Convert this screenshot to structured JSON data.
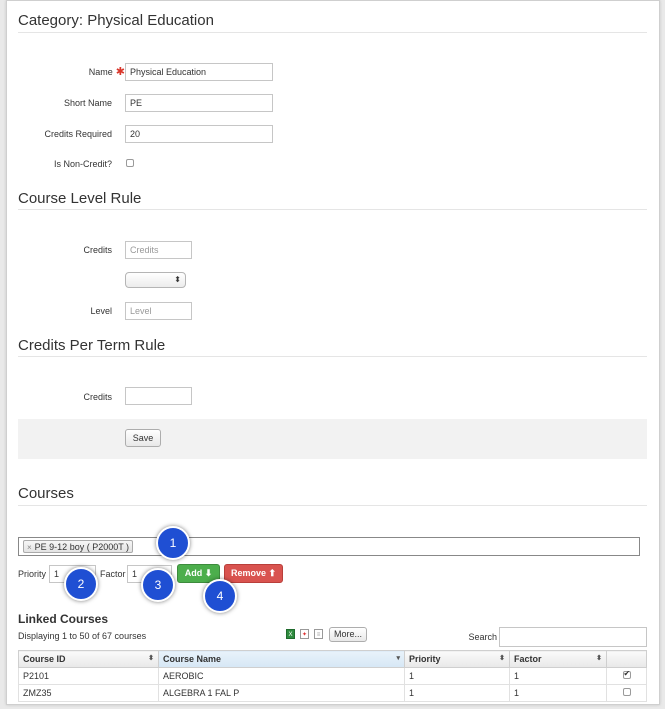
{
  "page_title": "Category: Physical Education",
  "fields": {
    "name_label": "Name",
    "name_required_mark": "✱",
    "name_value": "Physical Education",
    "short_name_label": "Short Name",
    "short_name_value": "PE",
    "credits_required_label": "Credits Required",
    "credits_required_value": "20",
    "non_credit_label": "Is Non-Credit?",
    "non_credit_checked": false
  },
  "course_level_rule": {
    "heading": "Course Level Rule",
    "credits_label": "Credits",
    "credits_placeholder": "Credits",
    "operator_value": "",
    "level_label": "Level",
    "level_placeholder": "Level"
  },
  "credits_per_term_rule": {
    "heading": "Credits Per Term Rule",
    "credits_label": "Credits",
    "credits_value": ""
  },
  "save_label": "Save",
  "courses": {
    "heading": "Courses",
    "selected_tag": "PE 9-12 boy ( P2000T )",
    "tag_remove_glyph": "×",
    "priority_label": "Priority",
    "priority_value": "1",
    "factor_label": "Factor",
    "factor_value": "1",
    "add_label": "Add ⬇",
    "remove_label": "Remove ⬆"
  },
  "callouts": [
    "1",
    "2",
    "3",
    "4"
  ],
  "linked_courses": {
    "heading": "Linked Courses",
    "displaying": "Displaying 1 to 50 of 67 courses",
    "more_label": "More...",
    "search_label": "Search",
    "search_value": "",
    "export_icons": [
      "excel-icon",
      "pdf-icon",
      "document-icon"
    ],
    "columns": [
      "Course ID",
      "Course Name",
      "Priority",
      "Factor",
      ""
    ],
    "rows": [
      {
        "course_id": "P2101",
        "course_name": "AEROBIC",
        "priority": "1",
        "factor": "1",
        "checked": true
      },
      {
        "course_id": "ZMZ35",
        "course_name": "ALGEBRA 1 FAL P",
        "priority": "1",
        "factor": "1",
        "checked": false
      }
    ]
  }
}
